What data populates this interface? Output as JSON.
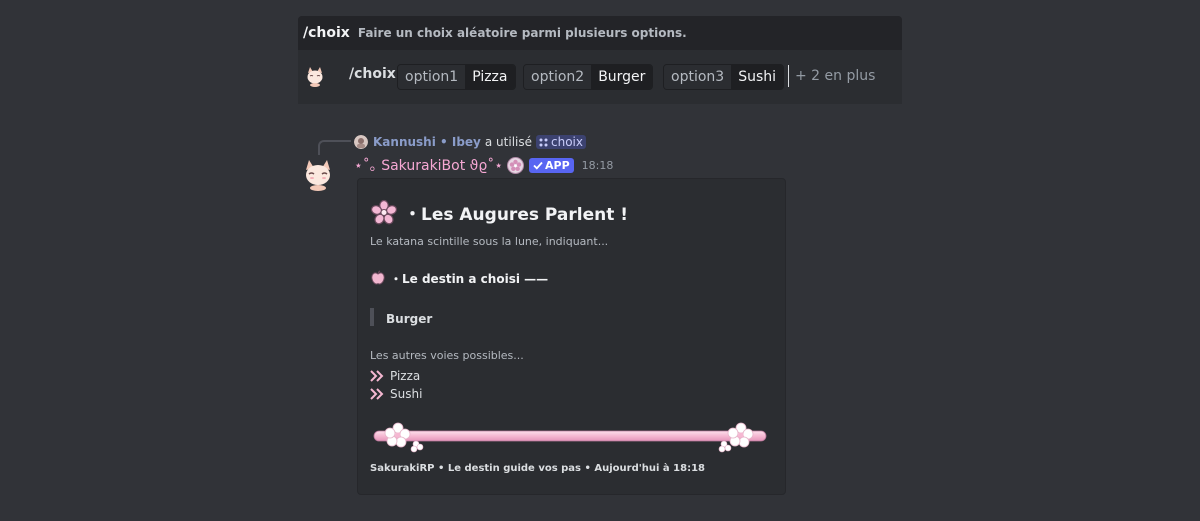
{
  "command_panel": {
    "command_name": "/choix",
    "description": "Faire un choix aléatoire parmi plusieurs options.",
    "input_command": "/choix",
    "options": [
      {
        "name": "option1",
        "value": "Pizza"
      },
      {
        "name": "option2",
        "value": "Burger"
      },
      {
        "name": "option3",
        "value": "Sushi"
      }
    ],
    "more_label": "+ 2 en plus"
  },
  "message": {
    "reply": {
      "user": "Kannushi • Ibey",
      "used_text": "a utilisé",
      "command_chip": "choix"
    },
    "author": {
      "name": "⋆˚｡ SakurakiBot ϑϱ˚⋆",
      "badge": "APP",
      "timestamp": "18:18"
    },
    "embed": {
      "title": "・Les Augures Parlent !",
      "description": "Le katana scintille sous la lune, indiquant...",
      "destiny_heading": "・Le destin a choisi ——",
      "chosen": "Burger",
      "others_heading": "Les autres voies possibles...",
      "others": [
        "Pizza",
        "Sushi"
      ],
      "footer": "SakurakiRP • Le destin guide vos pas • Aujourd'hui à 18:18"
    }
  },
  "colors": {
    "background": "#313338",
    "panel": "#2b2d31",
    "bot_name": "#f6a8d4",
    "app_badge": "#5865f2",
    "accent_pink": "#f5b8d2"
  }
}
